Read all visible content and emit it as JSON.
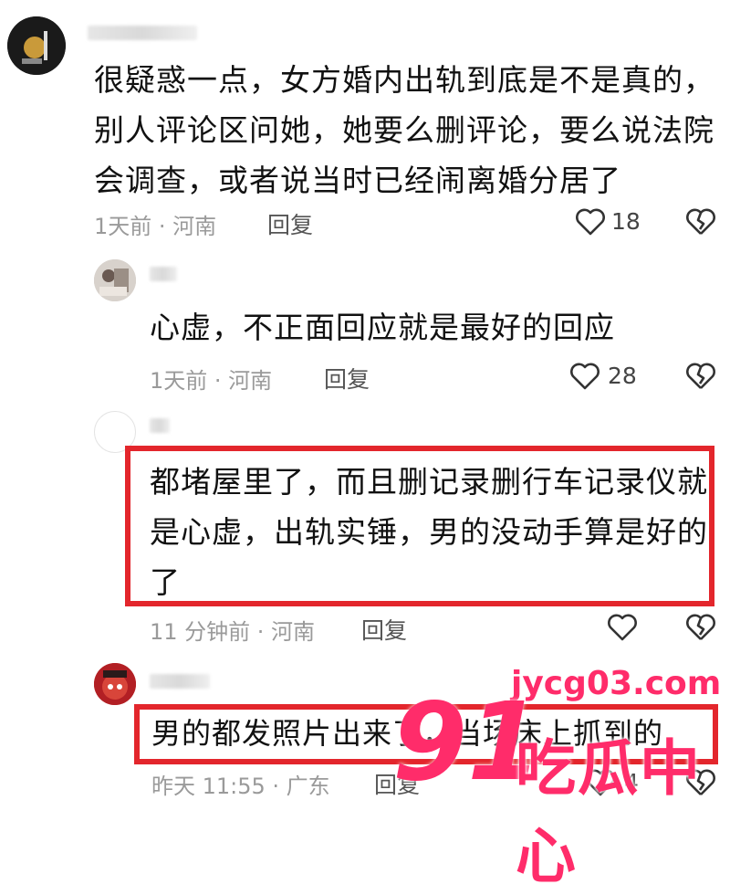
{
  "comments": [
    {
      "text_lines": [
        "很疑惑一点，女方婚内出轨到底是不是真的，",
        "别人评论区问她，她要么删评论，要么说法院",
        "会调查，或者说当时已经闹离婚分居了"
      ],
      "meta": "1天前 · 河南",
      "reply_label": "回复",
      "likes": "18"
    },
    {
      "text_lines": [
        "心虚，不正面回应就是最好的回应"
      ],
      "meta": "1天前 · 河南",
      "reply_label": "回复",
      "likes": "28"
    },
    {
      "text_lines": [
        "都堵屋里了，而且删记录删行车记录仪就",
        "是心虚，出轨实锤，男的没动手算是好的",
        "了"
      ],
      "meta": "11 分钟前 · 河南",
      "reply_label": "回复",
      "likes": ""
    },
    {
      "text_lines": [
        "男的都发照片出来了，当场床上抓到的"
      ],
      "meta": "昨天 11:55 · 广东",
      "reply_label": "回复",
      "likes": "4"
    }
  ],
  "watermark": {
    "domain": "jycg03.com",
    "number": "91",
    "brand": "吃瓜中心"
  },
  "colors": {
    "highlight": "#e3262c",
    "watermark": "#ff2c6a",
    "meta": "#9a9a9a"
  },
  "icons": [
    "heart-outline-icon",
    "broken-heart-icon"
  ]
}
